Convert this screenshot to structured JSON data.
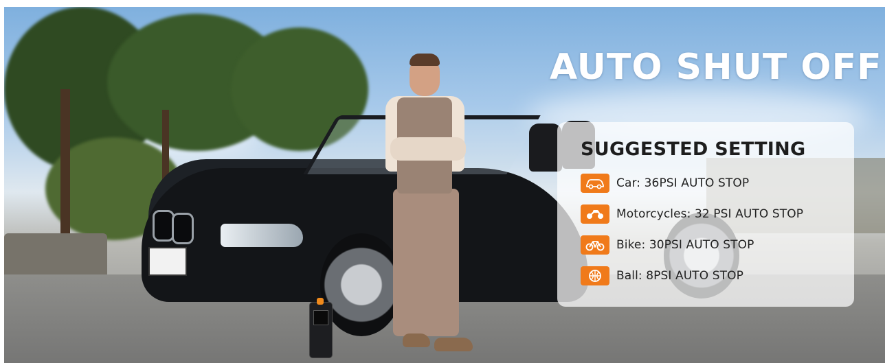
{
  "headline": "AUTO SHUT OFF",
  "card": {
    "title": "SUGGESTED SETTING",
    "items": [
      {
        "icon": "car-icon",
        "label": "Car: 36PSI AUTO STOP"
      },
      {
        "icon": "motorcycle-icon",
        "label": "Motorcycles: 32 PSI AUTO STOP"
      },
      {
        "icon": "bike-icon",
        "label": "Bike: 30PSI AUTO STOP"
      },
      {
        "icon": "ball-icon",
        "label": "Ball: 8PSI AUTO STOP"
      }
    ]
  },
  "colors": {
    "accent_orange": "#f07a1a",
    "headline_text": "#ffffff",
    "card_background": "#ffffffb8",
    "card_text": "#1d1d1d"
  }
}
